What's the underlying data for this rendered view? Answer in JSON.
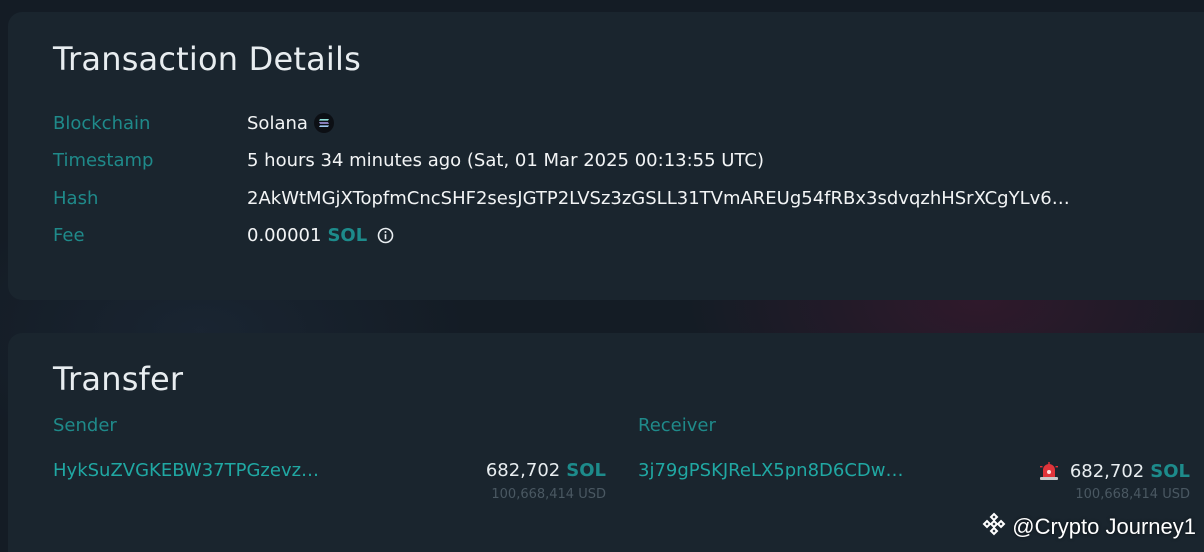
{
  "details": {
    "title": "Transaction Details",
    "rows": {
      "blockchain": {
        "label": "Blockchain",
        "value": "Solana"
      },
      "timestamp": {
        "label": "Timestamp",
        "value": "5 hours 34 minutes ago (Sat, 01 Mar 2025 00:13:55 UTC)"
      },
      "hash": {
        "label": "Hash",
        "value": "2AkWtMGjXTopfmCncSHF2sesJGTP2LVSz3zGSLL31TVmAREUg54fRBx3sdvqzhHSrXCgYLv6…"
      },
      "fee": {
        "label": "Fee",
        "amount": "0.00001",
        "token": "SOL"
      }
    }
  },
  "transfer": {
    "title": "Transfer",
    "sender": {
      "label": "Sender",
      "address": "HykSuZVGKEBW37TPGzevz…",
      "amount": "682,702",
      "token": "SOL",
      "usd": "100,668,414 USD"
    },
    "receiver": {
      "label": "Receiver",
      "address": "3j79gPSKJReLX5pn8D6CDw…",
      "amount": "682,702",
      "token": "SOL",
      "usd": "100,668,414 USD"
    }
  },
  "watermark": {
    "text": "@Crypto Journey1"
  },
  "icons": {
    "chain": "solana-icon",
    "fee_info": "info-icon",
    "receiver_flag": "alarm-icon",
    "watermark_logo": "binance-logo"
  },
  "colors": {
    "accent": "#20a8a3",
    "label": "#1f8a8a",
    "card": "#1a252e",
    "alarm": "#e0343a"
  }
}
